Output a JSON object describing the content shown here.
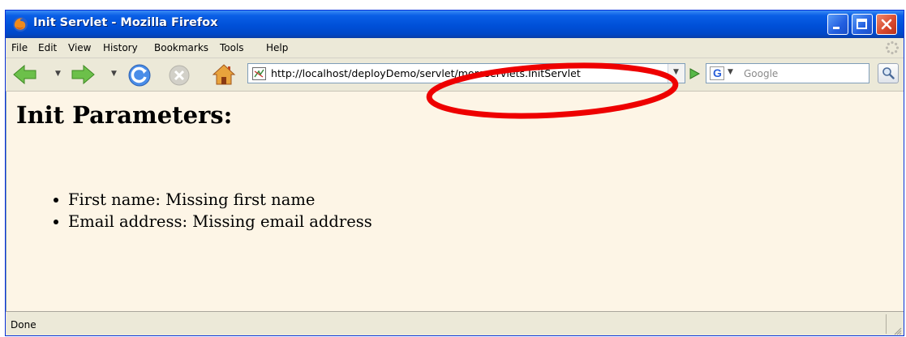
{
  "window": {
    "title": "Init Servlet - Mozilla Firefox",
    "icon": "firefox-icon"
  },
  "controls": {
    "minimize": "minimize-icon",
    "maximize": "maximize-icon",
    "close": "close-icon"
  },
  "menu": {
    "items": [
      "File",
      "Edit",
      "View",
      "History",
      "Bookmarks",
      "Tools",
      "Help"
    ]
  },
  "toolbar": {
    "back": "back-arrow-icon",
    "forward": "forward-arrow-icon",
    "reload": "reload-icon",
    "stop": "stop-icon",
    "home": "home-icon",
    "go": "go-icon"
  },
  "address": {
    "url": "http://localhost/deployDemo/servlet/moreservlets.InitServlet"
  },
  "search": {
    "placeholder": "Google",
    "engine": "G"
  },
  "page": {
    "heading": "Init Parameters:",
    "items": [
      "First name: Missing first name",
      "Email address: Missing email address"
    ]
  },
  "status": {
    "text": "Done"
  },
  "annotation": {
    "color": "#ee0000",
    "target": "url-path-highlight"
  },
  "colors": {
    "page_bg": "#fdf5e6",
    "titlebar": "#0050d8",
    "chrome": "#ece9d8"
  }
}
